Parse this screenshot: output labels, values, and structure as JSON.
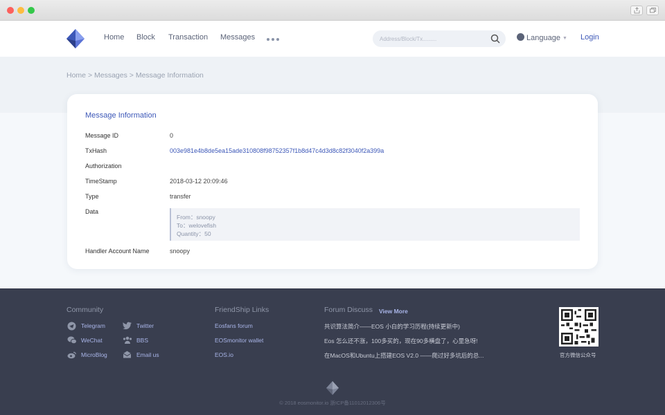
{
  "window": {
    "title_buttons": [
      "share-icon",
      "tabs-icon"
    ]
  },
  "nav": {
    "items": [
      "Home",
      "Block",
      "Transaction",
      "Messages"
    ],
    "search_placeholder": "Address/Block/Tx.........",
    "language": "Language",
    "login": "Login"
  },
  "breadcrumb": {
    "home": "Home",
    "separator": ">",
    "messages": "Messages",
    "current": "Message Information"
  },
  "message": {
    "title": "Message Information",
    "fields": [
      {
        "label": "Message ID",
        "value": "0"
      },
      {
        "label": "TxHash",
        "value": "003e981e4b8de5ea15ade310808f98752357f1b8d47c4d3d8c82f3040f2a399a"
      },
      {
        "label": "Authorization",
        "value": ""
      },
      {
        "label": "TimeStamp",
        "value": "2018-03-12 20:09:46"
      },
      {
        "label": "Type",
        "value": "transfer"
      },
      {
        "label": "Data",
        "value": ""
      },
      {
        "label": "Handler Account Name",
        "value": "snoopy"
      }
    ],
    "data_lines": [
      "From：snoopy",
      "To：welovefish",
      "Quantity：50"
    ]
  },
  "footer": {
    "community": {
      "heading": "Community",
      "links": [
        "Telegram",
        "Twitter",
        "WeChat",
        "BBS",
        "MicroBlog",
        "Email us"
      ]
    },
    "friendship": {
      "heading": "FriendShip Links",
      "links": [
        "Eosfans forum",
        "EOSmonitor wallet",
        "EOS.io"
      ]
    },
    "forum": {
      "heading": "Forum Discuss",
      "view_more": "View More",
      "items": [
        "共识算法简介——EOS 小白的学习历程(持续更新中)",
        "Eos 怎么还不涨，100多买的，现在90多横盘了，心里急呀!",
        "在MacOS和Ubuntu上搭建EOS V2.0 ——爬过好多坑后的总..."
      ]
    },
    "qr_caption": "官方微信公众号",
    "copyright": "© 2018 eosmonitor.io    浙ICP备11012012306号"
  },
  "colors": {
    "accent": "#3d58b8",
    "footer_bg": "#393e4f",
    "banner_bg": "#eef2f6"
  }
}
